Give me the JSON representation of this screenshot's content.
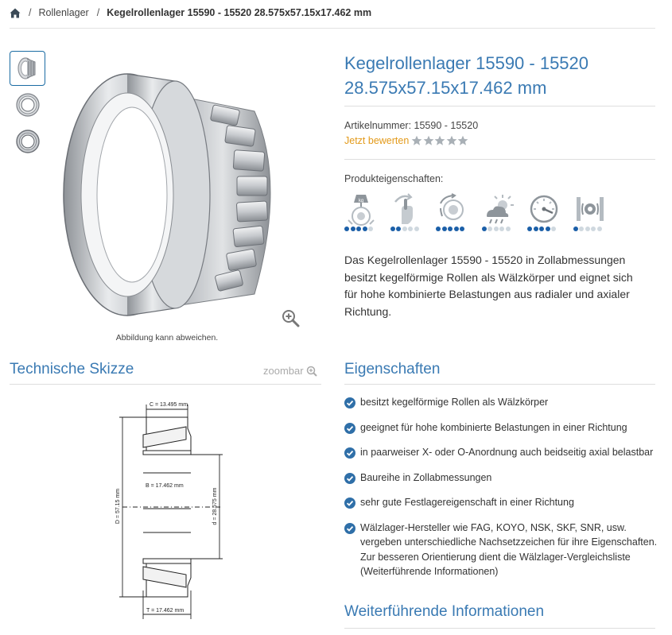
{
  "breadcrumb": {
    "home_icon": "home-icon",
    "separator": "/",
    "items": [
      {
        "label": "Rollenlager"
      },
      {
        "label": "Kegelrollenlager 15590 - 15520 28.575x57.15x17.462 mm"
      }
    ]
  },
  "gallery": {
    "thumbnails": [
      "tapered-roller-bearing-thumb",
      "bearing-front-thumb",
      "bearing-angle-thumb"
    ],
    "caption": "Abbildung kann abweichen."
  },
  "product": {
    "title_line1": "Kegelrollenlager 15590 - 15520",
    "title_line2": "28.575x57.15x17.462 mm",
    "article_number": "Artikelnummer: 15590 - 15520",
    "rate_label": "Jetzt bewerten",
    "stars": 5,
    "properties_label": "Produkteigenschaften:",
    "properties": [
      {
        "icon": "load-weight-icon",
        "level": 4,
        "max": 5
      },
      {
        "icon": "hand-rotation-icon",
        "level": 2,
        "max": 5
      },
      {
        "icon": "speed-rotation-icon",
        "level": 5,
        "max": 5
      },
      {
        "icon": "weather-icon",
        "level": 1,
        "max": 5
      },
      {
        "icon": "speedometer-icon",
        "level": 4,
        "max": 5
      },
      {
        "icon": "noise-icon",
        "level": 1,
        "max": 5
      }
    ],
    "description": "Das Kegelrollenlager 15590 - 15520 in Zollabmessungen besitzt kegelförmige Rollen als Wälzkörper und eignet sich für hohe kombinierte Belastungen aus radialer und axialer Richtung."
  },
  "sketch": {
    "title": "Technische Skizze",
    "zoom_label": "zoombar",
    "dim_C": "C = 13.495 mm",
    "dim_B": "B = 17.462 mm",
    "dim_D": "D = 57.15 mm",
    "dim_d": "d = 28.575 mm",
    "dim_T": "T = 17.462 mm"
  },
  "features": {
    "title": "Eigenschaften",
    "items": [
      "besitzt kegelförmige Rollen als Wälzkörper",
      "geeignet für hohe kombinierte Belastungen in einer Richtung",
      "in paarweiser X- oder O-Anordnung auch beidseitig axial belastbar",
      "Baureihe in Zollabmessungen",
      "sehr gute Festlagereigenschaft in einer Richtung",
      "Wälzlager-Hersteller wie FAG, KOYO, NSK, SKF, SNR, usw. vergeben unterschiedliche Nachsetzzeichen für ihre Eigenschaften. Zur besseren Orientierung dient die Wälzlager-Vergleichsliste (Weiterführende Informationen)"
    ]
  },
  "more_info": {
    "title": "Weiterführende Informationen"
  },
  "colors": {
    "accent": "#3a7ab3",
    "rating": "#e39a1a",
    "dot_active": "#1b5fa8",
    "dot_inactive": "#cfd8df"
  }
}
